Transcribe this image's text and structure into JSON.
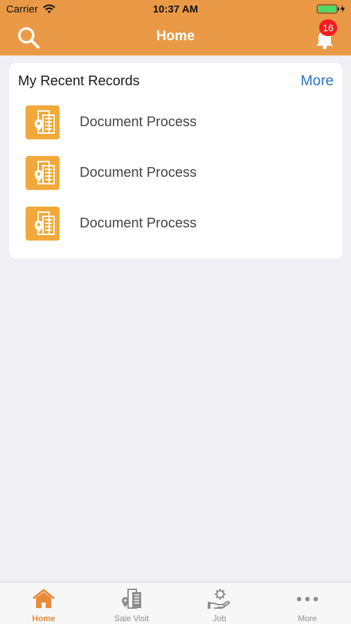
{
  "status_bar": {
    "carrier": "Carrier",
    "time": "10:37 AM"
  },
  "header": {
    "title": "Home",
    "notification_count": "16"
  },
  "recent": {
    "title": "My Recent Records",
    "more_label": "More",
    "items": [
      {
        "label": "Document Process",
        "icon": "building-location-icon"
      },
      {
        "label": "Document Process",
        "icon": "building-location-icon"
      },
      {
        "label": "Document Process",
        "icon": "building-location-icon"
      }
    ]
  },
  "tabs": [
    {
      "label": "Home",
      "icon": "home-icon",
      "active": true
    },
    {
      "label": "Sale Visit",
      "icon": "building-location-icon",
      "active": false
    },
    {
      "label": "Job",
      "icon": "hand-gear-icon",
      "active": false
    },
    {
      "label": "More",
      "icon": "more-dots-icon",
      "active": false
    }
  ],
  "colors": {
    "header_bg": "#ea9a46",
    "accent": "#ea8b3a",
    "link": "#2d76c4",
    "badge": "#f01e1e",
    "record_icon_bg": "#f2a93b",
    "battery": "#4cd964"
  }
}
